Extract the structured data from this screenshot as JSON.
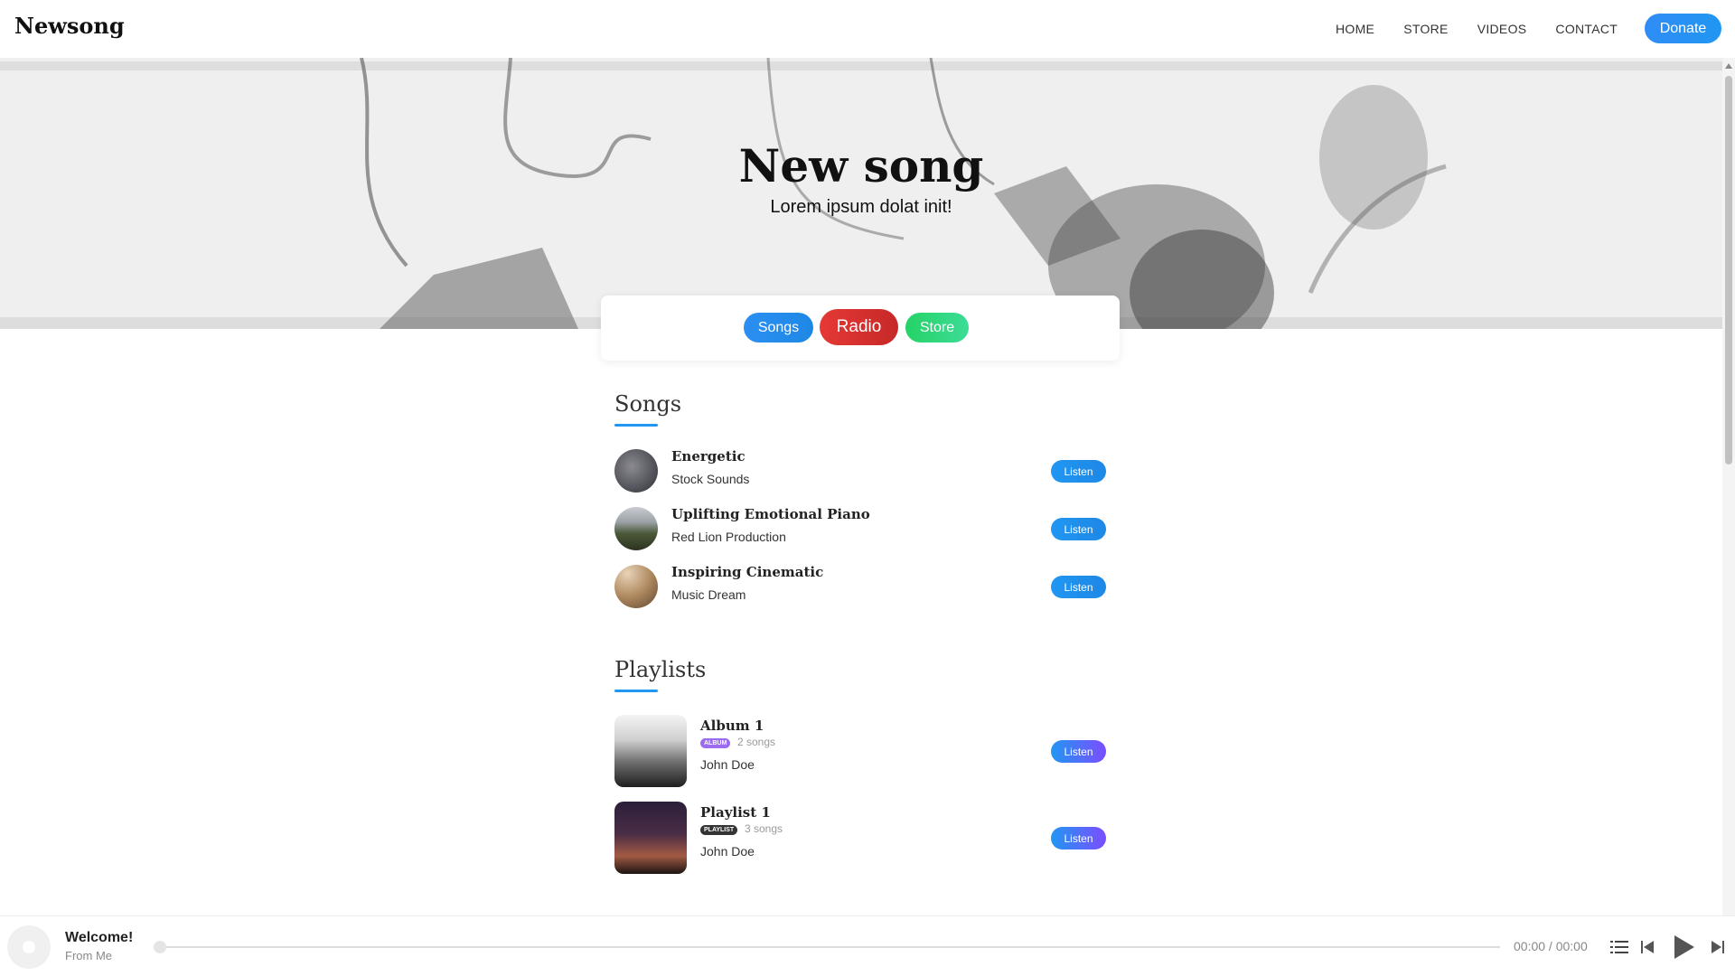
{
  "header": {
    "brand": "Newsong",
    "nav": [
      "HOME",
      "STORE",
      "VIDEOS",
      "CONTACT"
    ],
    "donate_label": "Donate"
  },
  "hero": {
    "title": "New song",
    "subtitle": "Lorem ipsum dolat init!"
  },
  "tabs": {
    "songs": "Songs",
    "radio": "Radio",
    "store": "Store"
  },
  "songs_section": {
    "title": "Songs",
    "items": [
      {
        "title": "Energetic",
        "artist": "Stock Sounds",
        "action": "Listen"
      },
      {
        "title": "Uplifting Emotional Piano",
        "artist": "Red Lion Production",
        "action": "Listen"
      },
      {
        "title": "Inspiring Cinematic",
        "artist": "Music Dream",
        "action": "Listen"
      }
    ]
  },
  "playlists_section": {
    "title": "Playlists",
    "items": [
      {
        "title": "Album 1",
        "badge": "ALBUM",
        "count": "2 songs",
        "owner": "John Doe",
        "action": "Listen"
      },
      {
        "title": "Playlist 1",
        "badge": "PLAYLIST",
        "count": "3 songs",
        "owner": "John Doe",
        "action": "Listen"
      }
    ]
  },
  "player": {
    "title": "Welcome!",
    "subtitle": "From Me",
    "time": "00:00 / 00:00",
    "progress": 0
  },
  "colors": {
    "accent": "#2196f3",
    "radio": "#d32f2f",
    "store": "#2ed573",
    "album_badge": "#9c6cf0",
    "playlist_badge": "#333333"
  }
}
